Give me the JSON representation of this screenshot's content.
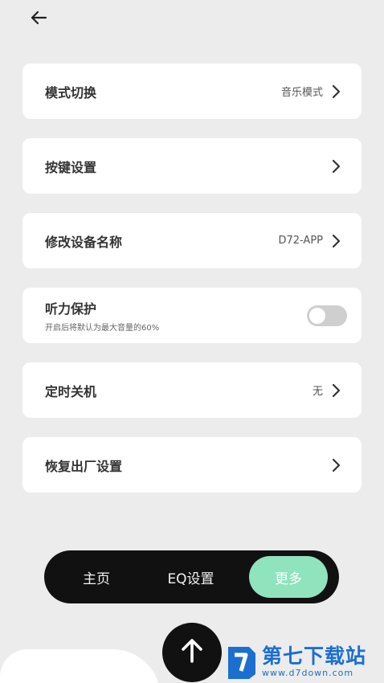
{
  "header": {
    "back_icon": "arrow-left-icon"
  },
  "settings": [
    {
      "title": "模式切换",
      "value": "音乐模式",
      "chevron": true
    },
    {
      "title": "按键设置",
      "value": "",
      "chevron": true
    },
    {
      "title": "修改设备名称",
      "value": "D72-APP",
      "chevron": true
    },
    {
      "title": "听力保护",
      "subtitle": "开启后将默认为最大音量的60%",
      "toggle_on": false
    },
    {
      "title": "定时关机",
      "value": "无",
      "chevron": true
    },
    {
      "title": "恢复出厂设置",
      "value": "",
      "chevron": true
    }
  ],
  "nav": {
    "home": "主页",
    "eq": "EQ设置",
    "more": "更多",
    "active": "more",
    "active_color": "#8fe3bd"
  },
  "fab": {
    "icon": "arrow-up-icon"
  },
  "watermark": {
    "main": "第七下载站",
    "url": "www.d7down.com",
    "color": "#1a6fd0"
  }
}
